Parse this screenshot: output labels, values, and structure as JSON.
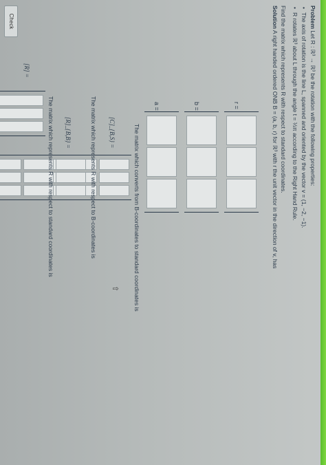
{
  "problem": {
    "heading": "Problem",
    "intro": "Let R : ℝ³ → ℝ³ be the rotation with the following properties:",
    "bullet1": "The axis of rotation is the line L, spanned and oriented by the vector v = (1, −2, −1).",
    "bullet2": "R rotates ℝ³ about L through the angle t = ⅓π according to the Right Hand Rule.",
    "find": "Find the matrix which represents R with respect to standard coordinates.",
    "solution_heading": "Solution",
    "solution": "A right handed ordered ONB B = (a, b, r) for ℝ³ with r the unit vector in the direction of v, has"
  },
  "vectors": {
    "r_label": "r =",
    "b_label": "b =",
    "a_label": "a ="
  },
  "matrices": {
    "c_intro": "The matrix which converts from B-coordinates to standard coordinates is",
    "c_label": "[C]_{B,S} =",
    "rb_intro": "The matrix which represents R with respect to B-coordinates is",
    "rb_label": "[R]_{B,B} =",
    "r_intro": "The matrix which represents R with respect to standard coordinates is",
    "r_label": "[R] ="
  },
  "actions": {
    "check_label": "Check"
  },
  "colors": {
    "accent_bar": "#6fcd36",
    "text": "#2b3a4a",
    "cell": "#e4e7e7"
  }
}
